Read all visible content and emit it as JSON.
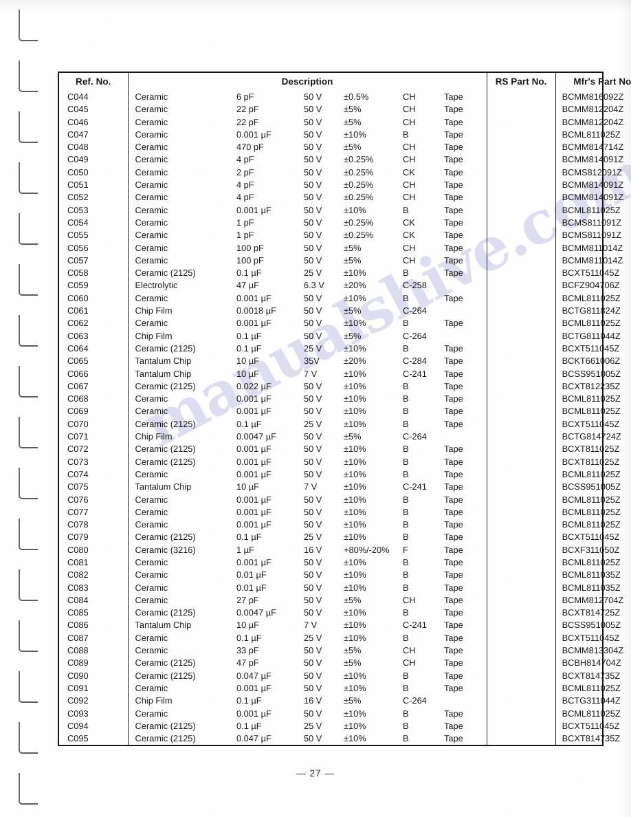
{
  "document": {
    "page_number": "— 27 —",
    "watermark_text": "manualshive.com",
    "watermark_color": "#8f93d6"
  },
  "table": {
    "headers": {
      "ref_no": "Ref. No.",
      "description": "Description",
      "rs_part_no": "RS Part No.",
      "mfr_part_no": "Mfr's Part No."
    },
    "rows": [
      {
        "ref": "C044",
        "type": "Ceramic",
        "value": "6 pF",
        "voltage": "50 V",
        "tolerance": "±0.5%",
        "code": "CH",
        "pack": "Tape",
        "rs": "",
        "mfr": "BCMM816092Z"
      },
      {
        "ref": "C045",
        "type": "Ceramic",
        "value": "22 pF",
        "voltage": "50 V",
        "tolerance": "±5%",
        "code": "CH",
        "pack": "Tape",
        "rs": "",
        "mfr": "BCMM812204Z"
      },
      {
        "ref": "C046",
        "type": "Ceramic",
        "value": "22 pF",
        "voltage": "50 V",
        "tolerance": "±5%",
        "code": "CH",
        "pack": "Tape",
        "rs": "",
        "mfr": "BCMM812204Z"
      },
      {
        "ref": "C047",
        "type": "Ceramic",
        "value": "0.001 µF",
        "voltage": "50 V",
        "tolerance": "±10%",
        "code": "B",
        "pack": "Tape",
        "rs": "",
        "mfr": "BCML811025Z"
      },
      {
        "ref": "C048",
        "type": "Ceramic",
        "value": "470 pF",
        "voltage": "50 V",
        "tolerance": "±5%",
        "code": "CH",
        "pack": "Tape",
        "rs": "",
        "mfr": "BCMM814714Z"
      },
      {
        "ref": "C049",
        "type": "Ceramic",
        "value": "4 pF",
        "voltage": "50 V",
        "tolerance": "±0.25%",
        "code": "CH",
        "pack": "Tape",
        "rs": "",
        "mfr": "BCMM814091Z"
      },
      {
        "ref": "C050",
        "type": "Ceramic",
        "value": "2 pF",
        "voltage": "50 V",
        "tolerance": "±0.25%",
        "code": "CK",
        "pack": "Tape",
        "rs": "",
        "mfr": "BCMS812091Z"
      },
      {
        "ref": "C051",
        "type": "Ceramic",
        "value": "4 pF",
        "voltage": "50 V",
        "tolerance": "±0.25%",
        "code": "CH",
        "pack": "Tape",
        "rs": "",
        "mfr": "BCMM814091Z"
      },
      {
        "ref": "C052",
        "type": "Ceramic",
        "value": "4 pF",
        "voltage": "50 V",
        "tolerance": "±0.25%",
        "code": "CH",
        "pack": "Tape",
        "rs": "",
        "mfr": "BCMM814091Z"
      },
      {
        "ref": "C053",
        "type": "Ceramic",
        "value": "0.001 µF",
        "voltage": "50 V",
        "tolerance": "±10%",
        "code": "B",
        "pack": "Tape",
        "rs": "",
        "mfr": "BCML811025Z"
      },
      {
        "ref": "C054",
        "type": "Ceramic",
        "value": "1 pF",
        "voltage": "50 V",
        "tolerance": "±0.25%",
        "code": "CK",
        "pack": "Tape",
        "rs": "",
        "mfr": "BCMS811091Z"
      },
      {
        "ref": "C055",
        "type": "Ceramic",
        "value": "1 pF",
        "voltage": "50 V",
        "tolerance": "±0.25%",
        "code": "CK",
        "pack": "Tape",
        "rs": "",
        "mfr": "BCMS811091Z"
      },
      {
        "ref": "C056",
        "type": "Ceramic",
        "value": "100 pF",
        "voltage": "50 V",
        "tolerance": "±5%",
        "code": "CH",
        "pack": "Tape",
        "rs": "",
        "mfr": "BCMM811014Z"
      },
      {
        "ref": "C057",
        "type": "Ceramic",
        "value": "100 pF",
        "voltage": "50 V",
        "tolerance": "±5%",
        "code": "CH",
        "pack": "Tape",
        "rs": "",
        "mfr": "BCMM811014Z"
      },
      {
        "ref": "C058",
        "type": "Ceramic (2125)",
        "value": "0.1 µF",
        "voltage": "25 V",
        "tolerance": "±10%",
        "code": "B",
        "pack": "Tape",
        "rs": "",
        "mfr": "BCXT511045Z"
      },
      {
        "ref": "C059",
        "type": "Electrolytic",
        "value": "47 µF",
        "voltage": "6.3 V",
        "tolerance": "±20%",
        "code": "C-258",
        "pack": "",
        "rs": "",
        "mfr": "BCFZ904706Z"
      },
      {
        "ref": "C060",
        "type": "Ceramic",
        "value": "0.001 µF",
        "voltage": "50 V",
        "tolerance": "±10%",
        "code": "B",
        "pack": "Tape",
        "rs": "",
        "mfr": "BCML811025Z"
      },
      {
        "ref": "C061",
        "type": "Chip Film",
        "value": "0.0018 µF",
        "voltage": "50 V",
        "tolerance": "±5%",
        "code": "C-264",
        "pack": "",
        "rs": "",
        "mfr": "BCTG811824Z"
      },
      {
        "ref": "C062",
        "type": "Ceramic",
        "value": "0.001 µF",
        "voltage": "50 V",
        "tolerance": "±10%",
        "code": "B",
        "pack": "Tape",
        "rs": "",
        "mfr": "BCML811025Z"
      },
      {
        "ref": "C063",
        "type": "Chip Film",
        "value": "0.1 µF",
        "voltage": "50 V",
        "tolerance": "±5%",
        "code": "C-264",
        "pack": "",
        "rs": "",
        "mfr": "BCTG811044Z"
      },
      {
        "ref": "C064",
        "type": "Ceramic (2125)",
        "value": "0.1 µF",
        "voltage": "25 V",
        "tolerance": "±10%",
        "code": "B",
        "pack": "Tape",
        "rs": "",
        "mfr": "BCXT511045Z"
      },
      {
        "ref": "C065",
        "type": "Tantalum Chip",
        "value": "10 µF",
        "voltage": "35V",
        "tolerance": "±20%",
        "code": "C-284",
        "pack": "Tape",
        "rs": "",
        "mfr": "BCKT661006Z"
      },
      {
        "ref": "C066",
        "type": "Tantalum Chip",
        "value": "10 µF",
        "voltage": "7 V",
        "tolerance": "±10%",
        "code": "C-241",
        "pack": "Tape",
        "rs": "",
        "mfr": "BCSS951005Z"
      },
      {
        "ref": "C067",
        "type": "Ceramic (2125)",
        "value": "0.022 µF",
        "voltage": "50 V",
        "tolerance": "±10%",
        "code": "B",
        "pack": "Tape",
        "rs": "",
        "mfr": "BCXT812235Z"
      },
      {
        "ref": "C068",
        "type": "Ceramic",
        "value": "0.001 µF",
        "voltage": "50 V",
        "tolerance": "±10%",
        "code": "B",
        "pack": "Tape",
        "rs": "",
        "mfr": "BCML811025Z"
      },
      {
        "ref": "C069",
        "type": "Ceramic",
        "value": "0.001 µF",
        "voltage": "50 V",
        "tolerance": "±10%",
        "code": "B",
        "pack": "Tape",
        "rs": "",
        "mfr": "BCML811025Z"
      },
      {
        "ref": "C070",
        "type": "Ceramic (2125)",
        "value": "0.1 µF",
        "voltage": "25 V",
        "tolerance": "±10%",
        "code": "B",
        "pack": "Tape",
        "rs": "",
        "mfr": "BCXT511045Z"
      },
      {
        "ref": "C071",
        "type": "Chip Film",
        "value": "0.0047 µF",
        "voltage": "50 V",
        "tolerance": "±5%",
        "code": "C-264",
        "pack": "",
        "rs": "",
        "mfr": "BCTG814724Z"
      },
      {
        "ref": "C072",
        "type": "Ceramic (2125)",
        "value": "0.001 µF",
        "voltage": "50 V",
        "tolerance": "±10%",
        "code": "B",
        "pack": "Tape",
        "rs": "",
        "mfr": "BCXT811025Z"
      },
      {
        "ref": "C073",
        "type": "Ceramic (2125)",
        "value": "0.001 µF",
        "voltage": "50 V",
        "tolerance": "±10%",
        "code": "B",
        "pack": "Tape",
        "rs": "",
        "mfr": "BCXT811025Z"
      },
      {
        "ref": "C074",
        "type": "Ceramic",
        "value": "0.001 µF",
        "voltage": "50 V",
        "tolerance": "±10%",
        "code": "B",
        "pack": "Tape",
        "rs": "",
        "mfr": "BCML811025Z"
      },
      {
        "ref": "C075",
        "type": "Tantalum Chip",
        "value": "10 µF",
        "voltage": "7 V",
        "tolerance": "±10%",
        "code": "C-241",
        "pack": "Tape",
        "rs": "",
        "mfr": "BCSS951005Z"
      },
      {
        "ref": "C076",
        "type": "Ceramic",
        "value": "0.001 µF",
        "voltage": "50 V",
        "tolerance": "±10%",
        "code": "B",
        "pack": "Tape",
        "rs": "",
        "mfr": "BCML811025Z"
      },
      {
        "ref": "C077",
        "type": "Ceramic",
        "value": "0.001 µF",
        "voltage": "50 V",
        "tolerance": "±10%",
        "code": "B",
        "pack": "Tape",
        "rs": "",
        "mfr": "BCML811025Z"
      },
      {
        "ref": "C078",
        "type": "Ceramic",
        "value": "0.001 µF",
        "voltage": "50 V",
        "tolerance": "±10%",
        "code": "B",
        "pack": "Tape",
        "rs": "",
        "mfr": "BCML811025Z"
      },
      {
        "ref": "C079",
        "type": "Ceramic (2125)",
        "value": "0.1 µF",
        "voltage": "25 V",
        "tolerance": "±10%",
        "code": "B",
        "pack": "Tape",
        "rs": "",
        "mfr": "BCXT511045Z"
      },
      {
        "ref": "C080",
        "type": "Ceramic (3216)",
        "value": "1 µF",
        "voltage": "16 V",
        "tolerance": "+80%/-20%",
        "code": "F",
        "pack": "Tape",
        "rs": "",
        "mfr": "BCXF311050Z"
      },
      {
        "ref": "C081",
        "type": "Ceramic",
        "value": "0.001 µF",
        "voltage": "50 V",
        "tolerance": "±10%",
        "code": "B",
        "pack": "Tape",
        "rs": "",
        "mfr": "BCML811025Z"
      },
      {
        "ref": "C082",
        "type": "Ceramic",
        "value": "0.01 µF",
        "voltage": "50 V",
        "tolerance": "±10%",
        "code": "B",
        "pack": "Tape",
        "rs": "",
        "mfr": "BCML811035Z"
      },
      {
        "ref": "C083",
        "type": "Ceramic",
        "value": "0.01 µF",
        "voltage": "50 V",
        "tolerance": "±10%",
        "code": "B",
        "pack": "Tape",
        "rs": "",
        "mfr": "BCML811035Z"
      },
      {
        "ref": "C084",
        "type": "Ceramic",
        "value": "27 pF",
        "voltage": "50 V",
        "tolerance": "±5%",
        "code": "CH",
        "pack": "Tape",
        "rs": "",
        "mfr": "BCMM812704Z"
      },
      {
        "ref": "C085",
        "type": "Ceramic (2125)",
        "value": "0.0047 µF",
        "voltage": "50 V",
        "tolerance": "±10%",
        "code": "B",
        "pack": "Tape",
        "rs": "",
        "mfr": "BCXT814725Z"
      },
      {
        "ref": "C086",
        "type": "Tantalum Chip",
        "value": "10 µF",
        "voltage": "7 V",
        "tolerance": "±10%",
        "code": "C-241",
        "pack": "Tape",
        "rs": "",
        "mfr": "BCSS951005Z"
      },
      {
        "ref": "C087",
        "type": "Ceramic",
        "value": "0.1 µF",
        "voltage": "25 V",
        "tolerance": "±10%",
        "code": "B",
        "pack": "Tape",
        "rs": "",
        "mfr": "BCXT511045Z"
      },
      {
        "ref": "C088",
        "type": "Ceramic",
        "value": "33 pF",
        "voltage": "50 V",
        "tolerance": "±5%",
        "code": "CH",
        "pack": "Tape",
        "rs": "",
        "mfr": "BCMM813304Z"
      },
      {
        "ref": "C089",
        "type": "Ceramic (2125)",
        "value": "47 pF",
        "voltage": "50 V",
        "tolerance": "±5%",
        "code": "CH",
        "pack": "Tape",
        "rs": "",
        "mfr": "BCBH814704Z"
      },
      {
        "ref": "C090",
        "type": "Ceramic (2125)",
        "value": "0.047 µF",
        "voltage": "50 V",
        "tolerance": "±10%",
        "code": "B",
        "pack": "Tape",
        "rs": "",
        "mfr": "BCXT814735Z"
      },
      {
        "ref": "C091",
        "type": "Ceramic",
        "value": "0.001 µF",
        "voltage": "50 V",
        "tolerance": "±10%",
        "code": "B",
        "pack": "Tape",
        "rs": "",
        "mfr": "BCML811025Z"
      },
      {
        "ref": "C092",
        "type": "Chip Film",
        "value": "0.1 µF",
        "voltage": "16 V",
        "tolerance": "±5%",
        "code": "C-264",
        "pack": "",
        "rs": "",
        "mfr": "BCTG311044Z"
      },
      {
        "ref": "C093",
        "type": "Ceramic",
        "value": "0.001 µF",
        "voltage": "50 V",
        "tolerance": "±10%",
        "code": "B",
        "pack": "Tape",
        "rs": "",
        "mfr": "BCML811025Z"
      },
      {
        "ref": "C094",
        "type": "Ceramic (2125)",
        "value": "0.1 µF",
        "voltage": "25 V",
        "tolerance": "±10%",
        "code": "B",
        "pack": "Tape",
        "rs": "",
        "mfr": "BCXT511045Z"
      },
      {
        "ref": "C095",
        "type": "Ceramic (2125)",
        "value": "0.047 µF",
        "voltage": "50 V",
        "tolerance": "±10%",
        "code": "B",
        "pack": "Tape",
        "rs": "",
        "mfr": "BCXT814735Z"
      }
    ]
  }
}
